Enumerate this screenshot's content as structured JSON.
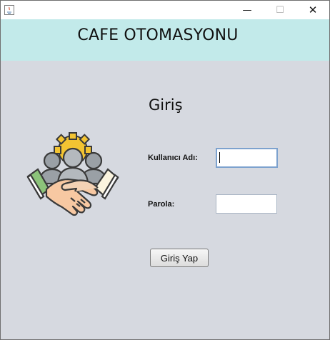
{
  "window": {
    "title": "",
    "controls": {
      "minimize": "—",
      "maximize": "☐",
      "close": "✕"
    }
  },
  "banner": {
    "title": "CAFE OTOMASYONU"
  },
  "login": {
    "heading": "Giriş",
    "username_label": "Kullanıcı Adı:",
    "username_value": "",
    "password_label": "Parola:",
    "password_value": "",
    "button_label": "Giriş Yap"
  },
  "icons": {
    "app": "java-app-icon",
    "illustration": "team-handshake-gear-icon"
  },
  "colors": {
    "banner_bg": "#c2eaea",
    "content_bg": "#d6d9e0",
    "gear": "#f3c432",
    "people_gray": "#9aa0a6",
    "hand_left": "#f7c8a2",
    "hand_right": "#f3d2b5",
    "sleeve_green": "#8cc37a",
    "sleeve_cream": "#fbf4df",
    "outline": "#3a3a3a"
  }
}
